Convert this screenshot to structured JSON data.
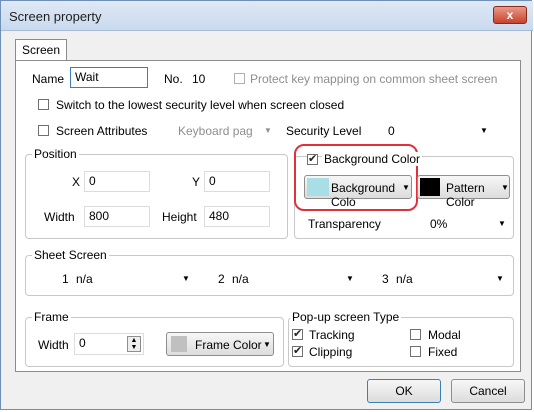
{
  "window": {
    "title": "Screen property",
    "close_label": "x"
  },
  "tab": {
    "label": "Screen"
  },
  "general": {
    "name_label": "Name",
    "name_value": "Wait",
    "no_label": "No.",
    "no_value": "10",
    "protect_label": "Protect key mapping on common sheet screen",
    "switch_label": "Switch to the lowest security level when screen closed",
    "screen_attributes_label": "Screen Attributes",
    "keyboard_label": "Keyboard pag",
    "security_level_label": "Security Level",
    "security_level_value": "0"
  },
  "position": {
    "title": "Position",
    "x_label": "X",
    "x_value": "0",
    "y_label": "Y",
    "y_value": "0",
    "width_label": "Width",
    "width_value": "800",
    "height_label": "Height",
    "height_value": "480"
  },
  "background": {
    "checkbox_label": "Background Color",
    "bg_color_button": "Background Colo",
    "pattern_color_button": "Pattern Color",
    "transparency_label": "Transparency",
    "transparency_value": "0%",
    "bg_swatch_color": "#a8dfe6",
    "pattern_swatch_color": "#000000",
    "highlight_color": "#e0313a"
  },
  "sheet_screen": {
    "title": "Sheet Screen",
    "items": [
      {
        "num": "1",
        "value": "n/a"
      },
      {
        "num": "2",
        "value": "n/a"
      },
      {
        "num": "3",
        "value": "n/a"
      }
    ]
  },
  "frame": {
    "title": "Frame",
    "width_label": "Width",
    "width_value": "0",
    "color_button": "Frame Color",
    "swatch_color": "#c0c0c0"
  },
  "popup": {
    "title": "Pop-up screen Type",
    "tracking_label": "Tracking",
    "clipping_label": "Clipping",
    "modal_label": "Modal",
    "fixed_label": "Fixed"
  },
  "footer": {
    "ok_label": "OK",
    "cancel_label": "Cancel"
  }
}
